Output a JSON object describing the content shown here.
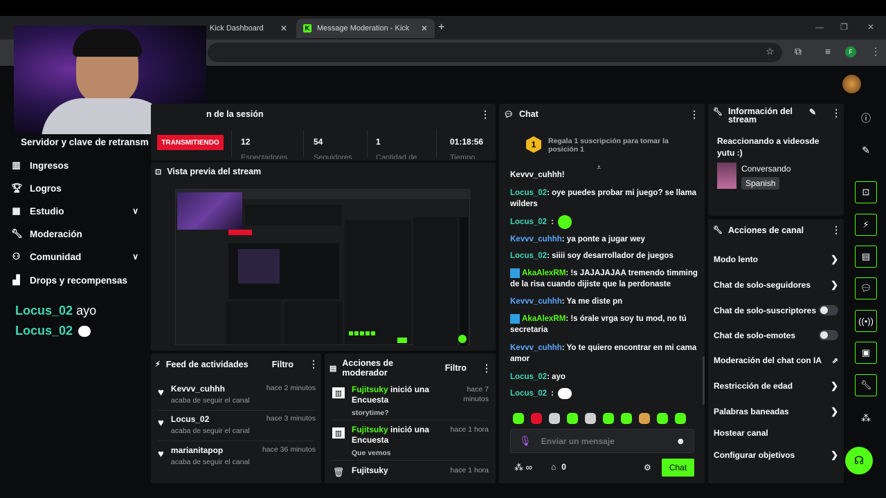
{
  "browser": {
    "tabs": [
      {
        "title": "Kick Dashboard"
      },
      {
        "title": "Message Moderation - Kick Da"
      }
    ],
    "new_tab": "+",
    "profile_initial": "F"
  },
  "sidebar": {
    "cut_title": "Servidor y clave de retransm",
    "items": [
      {
        "label": "Ingresos",
        "icon": "revenue-icon"
      },
      {
        "label": "Logros",
        "icon": "trophy-icon"
      },
      {
        "label": "Estudio",
        "icon": "studio-icon",
        "expandable": true
      },
      {
        "label": "Moderación",
        "icon": "wrench-icon"
      },
      {
        "label": "Comunidad",
        "icon": "community-icon",
        "expandable": true
      },
      {
        "label": "Drops y recompensas",
        "icon": "drops-icon"
      }
    ],
    "overlay_lines": [
      {
        "user": "Locus_02",
        "text": "ayo"
      },
      {
        "user": "Locus_02",
        "text": ""
      }
    ]
  },
  "session": {
    "title": "n de la sesión",
    "live_badge": "TRANSMITIENDO",
    "stats": [
      {
        "value": "12",
        "label": "Espectadores"
      },
      {
        "value": "54",
        "label": "Seguidores"
      },
      {
        "value": "1",
        "label": "Cantidad de"
      },
      {
        "value": "01:18:56",
        "label": "Tiempo"
      }
    ]
  },
  "preview": {
    "title": "Vista previa del stream"
  },
  "feed": {
    "title": "Feed de actividades",
    "filter": "Filtro",
    "items": [
      {
        "name": "Kevvv_cuhhh",
        "time": "hace 2 minutos",
        "sub": "acaba de seguir el canal"
      },
      {
        "name": "Locus_02",
        "time": "hace 3 minutos",
        "sub": "acaba de seguir el canal"
      },
      {
        "name": "marianitapop",
        "time": "hace 36 minutos",
        "sub": "acaba de seguir el canal"
      }
    ]
  },
  "modactions": {
    "title": "Acciones de moderador",
    "filter": "Filtro",
    "items": [
      {
        "user": "Fujitsuky",
        "text": " inició una Encuesta",
        "sub": "storytime?",
        "time": "hace 7 minutos"
      },
      {
        "user": "Fujitsuky",
        "text": " inició una Encuesta",
        "sub": "Que vemos",
        "time": "hace 1 hora"
      },
      {
        "user": "Fujitsuky",
        "text": "",
        "sub": "",
        "time": "hace 1 hora"
      }
    ]
  },
  "chat": {
    "title": "Chat",
    "pinned_rank": "1",
    "pinned_text": "Regala 1 suscripción para tomar la posición 1",
    "cut_top": "Kevvv_cuhhh!",
    "messages": [
      {
        "user": "Locus_02",
        "color": "teal",
        "text": "oye puedes probar mi juego? se llama wilders"
      },
      {
        "user": "Locus_02",
        "color": "teal",
        "text": ""
      },
      {
        "user": "Kevvv_cuhhh",
        "color": "blue",
        "text": "ya ponte a jugar wey"
      },
      {
        "user": "Locus_02",
        "color": "teal",
        "text": "siiii soy desarrollador de juegos"
      },
      {
        "user": "AkaAlexRM",
        "color": "green",
        "text": "!s JAJAJAJAA tremendo timming de la risa cuando dijiste que la perdonaste"
      },
      {
        "user": "Kevvv_cuhhh",
        "color": "blue",
        "text": "Ya me diste pn"
      },
      {
        "user": "AkaAlexRM",
        "color": "green",
        "text": "!s órale vrga soy tu mod, no tú secretaria"
      },
      {
        "user": "Kevvv_cuhhh",
        "color": "blue",
        "text": "Yo te quiero encontrar en mi cama amor"
      },
      {
        "user": "Locus_02",
        "color": "teal",
        "text": "ayo"
      },
      {
        "user": "Locus_02",
        "color": "teal",
        "text": ""
      }
    ],
    "input_placeholder": "Enviar un mensaje",
    "points": "0",
    "send_label": "Chat"
  },
  "info": {
    "title": "Información del stream",
    "stream_title": "Reaccionando a videosde yutu :)",
    "category": "Conversando",
    "language": "Spanish"
  },
  "channel_actions": {
    "title": "Acciones de canal",
    "items": [
      {
        "label": "Modo lento",
        "kind": "chevron"
      },
      {
        "label": "Chat de solo-seguidores",
        "kind": "chevron"
      },
      {
        "label": "Chat de solo-suscriptores",
        "kind": "toggle"
      },
      {
        "label": "Chat de solo-emotes",
        "kind": "toggle"
      },
      {
        "label": "Moderación del chat con IA",
        "kind": "external"
      },
      {
        "label": "Restricción de edad",
        "kind": "chevron"
      },
      {
        "label": "Palabras baneadas",
        "kind": "chevron"
      },
      {
        "label": "Hostear canal",
        "kind": "none"
      },
      {
        "label": "Configurar objetivos",
        "kind": "chevron"
      }
    ]
  },
  "colors": {
    "accent": "#53fc18",
    "live": "#e3112b",
    "panel": "#18191b"
  }
}
